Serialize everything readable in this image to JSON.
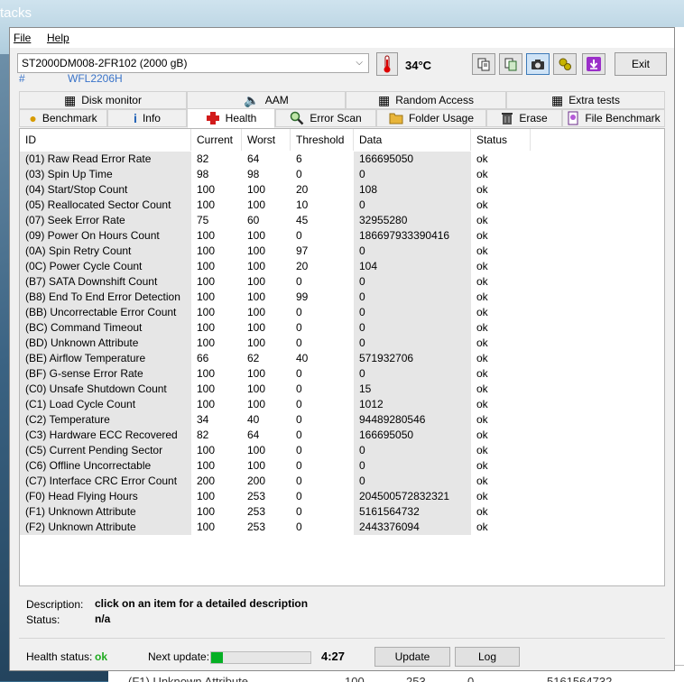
{
  "desktop": {
    "title_fragment": "tacks",
    "behind_row": [
      "(F1) Unknown Attribute",
      "100",
      "253",
      "0",
      "5161564732"
    ]
  },
  "menu": {
    "file": "File",
    "help": "Help"
  },
  "disk": {
    "selected": "ST2000DM008-2FR102 (2000 gB)",
    "hash": "#",
    "serial": "WFL2206H",
    "temperature": "34°C"
  },
  "toolbar": {
    "exit_label": "Exit"
  },
  "tabs_row1": [
    {
      "label": "Disk monitor",
      "icon": "disk-monitor-icon"
    },
    {
      "label": "AAM",
      "icon": "speaker-icon"
    },
    {
      "label": "Random Access",
      "icon": "random-access-icon"
    },
    {
      "label": "Extra tests",
      "icon": "extra-tests-icon"
    }
  ],
  "tabs_row2": [
    {
      "label": "Benchmark",
      "icon": "benchmark-icon"
    },
    {
      "label": "Info",
      "icon": "info-icon"
    },
    {
      "label": "Health",
      "icon": "health-cross-icon",
      "selected": true
    },
    {
      "label": "Error Scan",
      "icon": "magnifier-icon"
    },
    {
      "label": "Folder Usage",
      "icon": "folder-icon"
    },
    {
      "label": "Erase",
      "icon": "trash-icon"
    },
    {
      "label": "File Benchmark",
      "icon": "file-benchmark-icon"
    }
  ],
  "table": {
    "columns": [
      "ID",
      "Current",
      "Worst",
      "Threshold",
      "Data",
      "Status"
    ],
    "rows": [
      [
        "(01) Raw Read Error Rate",
        "82",
        "64",
        "6",
        "166695050",
        "ok"
      ],
      [
        "(03) Spin Up Time",
        "98",
        "98",
        "0",
        "0",
        "ok"
      ],
      [
        "(04) Start/Stop Count",
        "100",
        "100",
        "20",
        "108",
        "ok"
      ],
      [
        "(05) Reallocated Sector Count",
        "100",
        "100",
        "10",
        "0",
        "ok"
      ],
      [
        "(07) Seek Error Rate",
        "75",
        "60",
        "45",
        "32955280",
        "ok"
      ],
      [
        "(09) Power On Hours Count",
        "100",
        "100",
        "0",
        "186697933390416",
        "ok"
      ],
      [
        "(0A) Spin Retry Count",
        "100",
        "100",
        "97",
        "0",
        "ok"
      ],
      [
        "(0C) Power Cycle Count",
        "100",
        "100",
        "20",
        "104",
        "ok"
      ],
      [
        "(B7) SATA Downshift Count",
        "100",
        "100",
        "0",
        "0",
        "ok"
      ],
      [
        "(B8) End To End Error Detection",
        "100",
        "100",
        "99",
        "0",
        "ok"
      ],
      [
        "(BB) Uncorrectable Error Count",
        "100",
        "100",
        "0",
        "0",
        "ok"
      ],
      [
        "(BC) Command Timeout",
        "100",
        "100",
        "0",
        "0",
        "ok"
      ],
      [
        "(BD) Unknown Attribute",
        "100",
        "100",
        "0",
        "0",
        "ok"
      ],
      [
        "(BE) Airflow Temperature",
        "66",
        "62",
        "40",
        "571932706",
        "ok"
      ],
      [
        "(BF) G-sense Error Rate",
        "100",
        "100",
        "0",
        "0",
        "ok"
      ],
      [
        "(C0) Unsafe Shutdown Count",
        "100",
        "100",
        "0",
        "15",
        "ok"
      ],
      [
        "(C1) Load Cycle Count",
        "100",
        "100",
        "0",
        "1012",
        "ok"
      ],
      [
        "(C2) Temperature",
        "34",
        "40",
        "0",
        "94489280546",
        "ok"
      ],
      [
        "(C3) Hardware ECC Recovered",
        "82",
        "64",
        "0",
        "166695050",
        "ok"
      ],
      [
        "(C5) Current Pending Sector",
        "100",
        "100",
        "0",
        "0",
        "ok"
      ],
      [
        "(C6) Offline Uncorrectable",
        "100",
        "100",
        "0",
        "0",
        "ok"
      ],
      [
        "(C7) Interface CRC Error Count",
        "200",
        "200",
        "0",
        "0",
        "ok"
      ],
      [
        "(F0) Head Flying Hours",
        "100",
        "253",
        "0",
        "204500572832321",
        "ok"
      ],
      [
        "(F1) Unknown Attribute",
        "100",
        "253",
        "0",
        "5161564732",
        "ok"
      ],
      [
        "(F2) Unknown Attribute",
        "100",
        "253",
        "0",
        "2443376094",
        "ok"
      ]
    ]
  },
  "description": {
    "desc_label": "Description:",
    "desc_value": "click on an item for a detailed description",
    "status_label": "Status:",
    "status_value": "n/a"
  },
  "footer": {
    "health_label": "Health status:",
    "health_value": "ok",
    "next_update_label": "Next update:",
    "progress_fraction": 0.12,
    "countdown": "4:27",
    "update_button": "Update",
    "log_button": "Log"
  },
  "colors": {
    "ok_green": "#1faa1f",
    "progress_green": "#06b025",
    "serial_blue": "#3a74c9"
  }
}
